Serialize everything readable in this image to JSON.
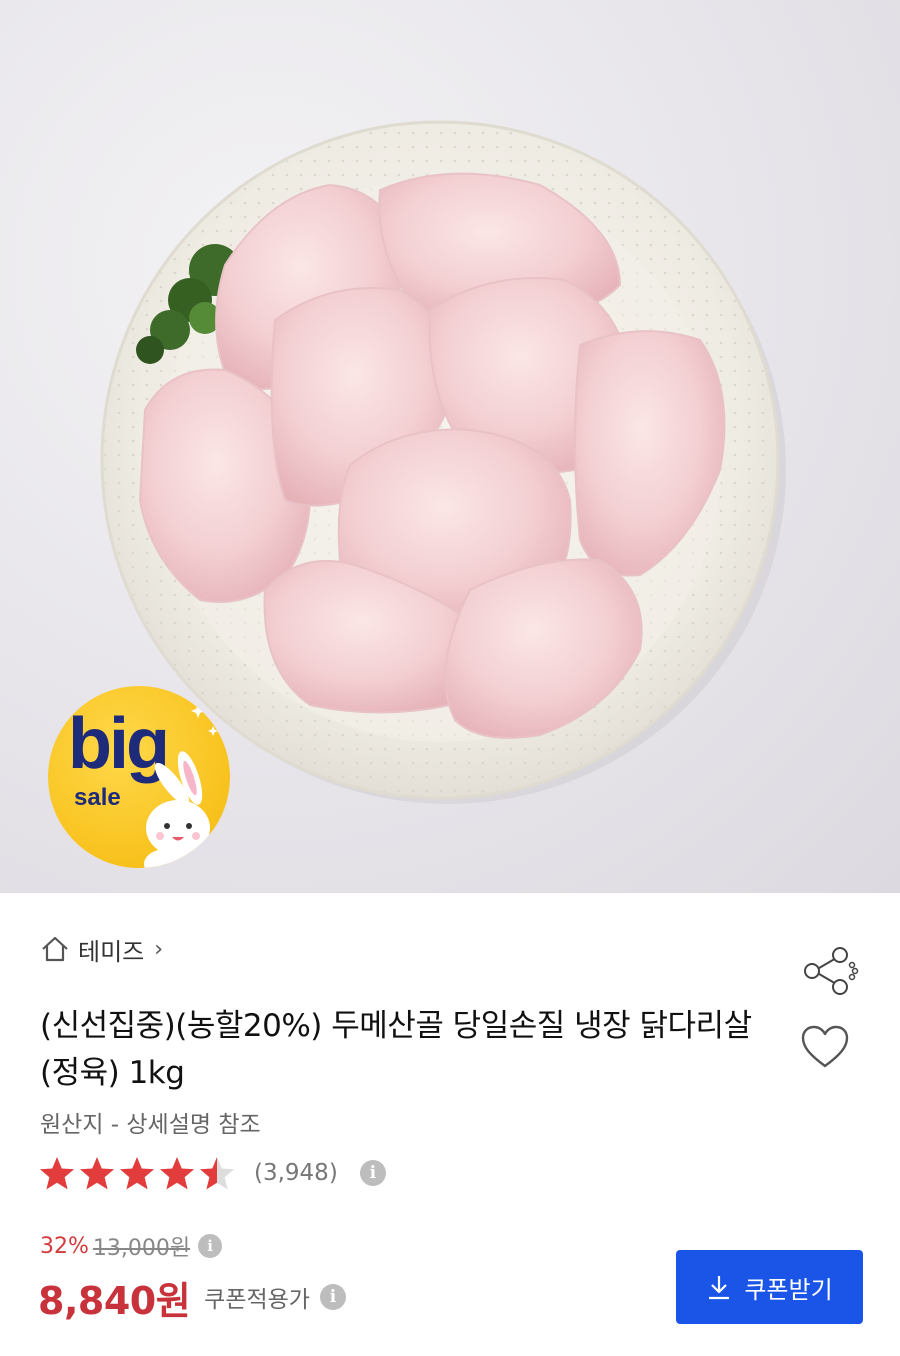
{
  "product_image": {
    "badge": {
      "big": "big",
      "sale": "sale"
    }
  },
  "brand": {
    "name": "테미즈",
    "chevron": "›"
  },
  "product": {
    "title": "(신선집중)(농할20%) 두메산골 당일손질 냉장 닭다리살(정육) 1kg",
    "origin": "원산지 - 상세설명 참조"
  },
  "rating": {
    "stars": 4.5,
    "max_stars": 5,
    "review_count": "(3,948)"
  },
  "price": {
    "discount": "32%",
    "original": "13,000원",
    "sale": "8,840원",
    "sale_label": "쿠폰적용가"
  },
  "actions": {
    "coupon_button": "쿠폰받기"
  },
  "icons": {
    "home": "home-icon",
    "share": "share-icon",
    "like": "heart-icon",
    "info": "info-icon",
    "download": "download-icon",
    "star": "star-icon"
  },
  "colors": {
    "accent_blue": "#1a55e8",
    "price_red": "#c8323a",
    "discount_red": "#d23c3c",
    "star_red": "#e23c3c",
    "badge_yellow": "#f8c21d"
  }
}
